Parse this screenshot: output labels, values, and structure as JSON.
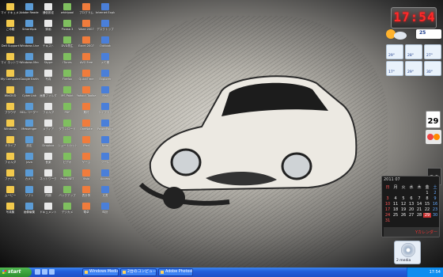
{
  "desktop": {
    "icons": [
      "マイ ドキュメント",
      "Adobe Reader",
      "通信設定",
      "whirlpool",
      "プログラム",
      "Internet Explorer",
      "ごみ箱",
      "SmartSpb",
      "録画",
      "Picasa 3",
      "Word 2007",
      "デスクトップ",
      "Dell Support",
      "Windows Live",
      "テキスト",
      "DVD再生",
      "Excel 2007",
      "Outlook",
      "マイ ネットワーク",
      "Windows Media Player",
      "Skype",
      "iTunes",
      "AVG Free",
      "メモ帳",
      "My Computer",
      "Google Earth",
      "写真",
      "Firefox",
      "QuickTime",
      "Explorer",
      "WinDVD",
      "CyberLink",
      "画像フォルダ",
      "MS Paint",
      "Yahoo! Toolbar",
      "Mail",
      "ブラウザ",
      "BDレコーダー",
      "フォルダ",
      "PDF",
      "素材",
      "ライブラリ",
      "Windows",
      "Messenger",
      "メディア",
      "ダウンロード",
      "OneNote",
      "PowerPoint",
      "ドライブ",
      "設定",
      "Dropbox",
      "ショートカット",
      "iPod",
      "Nero",
      "フォルダ",
      "Java",
      "音楽",
      "ビデオ",
      "ゲーム",
      "ツール",
      "ファイル",
      "カメラ",
      "ネットワーク",
      "Paint.NET",
      "Visio",
      "Access",
      "ムービー",
      "ソフト",
      "同期",
      "バックアップ",
      "表計算",
      "文書",
      "写真集",
      "画像編集",
      "ドキュメント",
      "デジカメ",
      "電卓",
      "時計"
    ]
  },
  "clock": {
    "time": "17:54"
  },
  "weather": {
    "now": "25",
    "tiles": [
      "29°",
      "28°",
      "27°",
      "17°",
      "29°",
      "30°"
    ]
  },
  "calendar": {
    "small_day": "29",
    "big_day": "29",
    "month_label": "2011 07",
    "weekdays": [
      "日",
      "月",
      "火",
      "水",
      "木",
      "金",
      "土"
    ],
    "days": [
      "",
      "",
      "",
      "",
      "",
      "1",
      "2",
      "3",
      "4",
      "5",
      "6",
      "7",
      "8",
      "9",
      "10",
      "11",
      "12",
      "13",
      "14",
      "15",
      "16",
      "17",
      "18",
      "19",
      "20",
      "21",
      "22",
      "23",
      "24",
      "25",
      "26",
      "27",
      "28",
      "29",
      "30",
      "31"
    ],
    "footer_label": "Yカレンダー"
  },
  "recycle": {
    "label": "2 media"
  },
  "taskbar": {
    "start_label": "start",
    "buttons": [
      "Windows Media Player",
      "2台のコンピュータ",
      "Adobe Photoshop"
    ],
    "tray_time": "17:54"
  },
  "colors": {
    "taskbar": "#245edb",
    "clock_digits": "#ff2a2a",
    "start": "#2d8e2d"
  }
}
